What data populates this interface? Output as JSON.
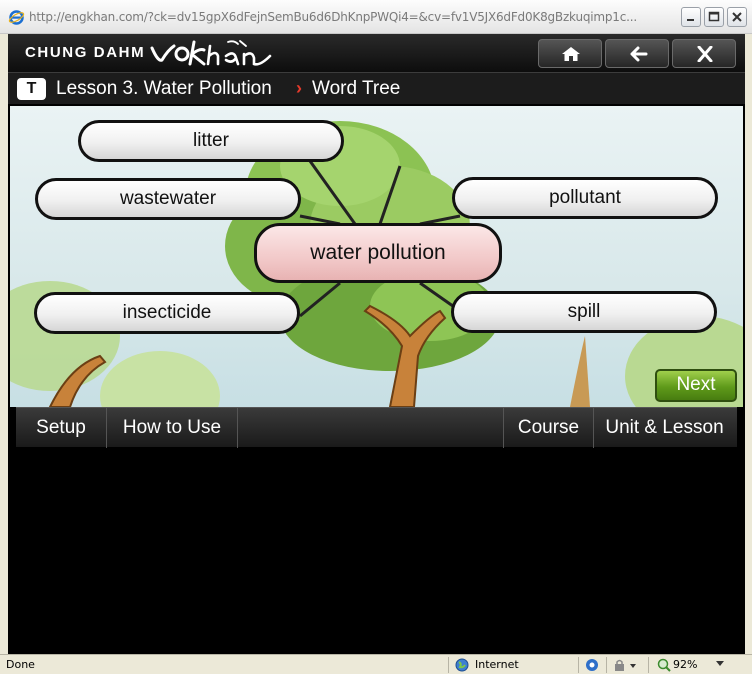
{
  "browser": {
    "url": "http://engkhan.com/?ck=dv15gpX6dFejnSemBu6d6DhKnpPWQi4=&cv=fv1V5JX6dFd0K8gBzkuqimp1c...",
    "status": "Done",
    "zone": "Internet",
    "zoom": "92%"
  },
  "app": {
    "brand_text": "CHUNG DAHM",
    "logo_text": "vokhan",
    "breadcrumb": {
      "badge": "T",
      "lesson": "Lesson 3. Water Pollution",
      "separator": "›",
      "section": "Word Tree"
    }
  },
  "word_tree": {
    "center": "water pollution",
    "words": [
      "litter",
      "wastewater",
      "pollutant",
      "insecticide",
      "spill"
    ],
    "next_label": "Next"
  },
  "nav": {
    "setup": "Setup",
    "how_to_use": "How to Use",
    "course": "Course",
    "unit_lesson": "Unit & Lesson"
  },
  "colors": {
    "accent_green": "#5f9a1a",
    "center_pink": "#f2c9c9",
    "breadcrumb_arrow": "#e53a2b"
  }
}
